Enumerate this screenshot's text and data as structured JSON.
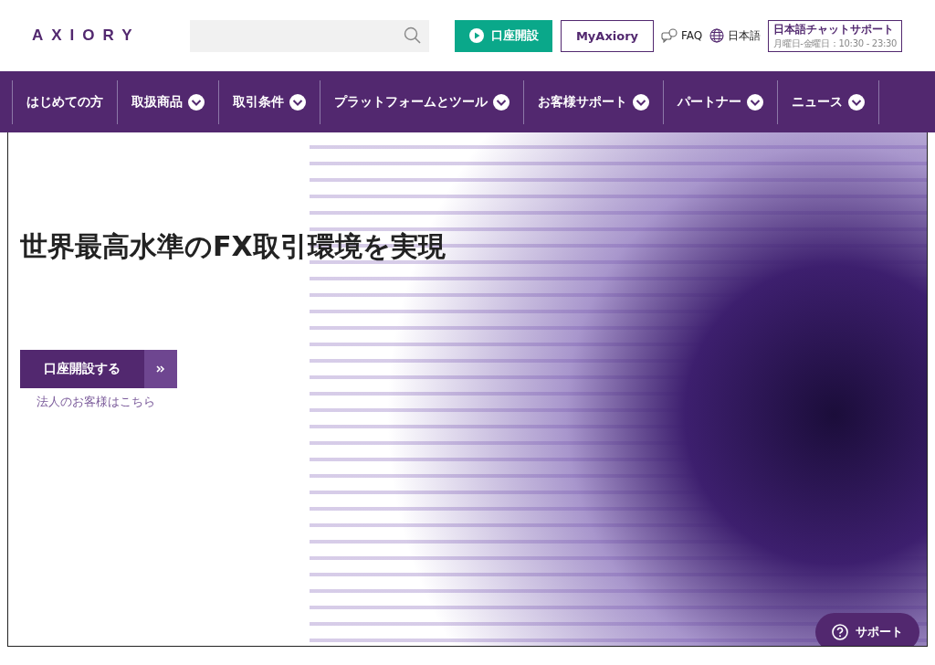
{
  "header": {
    "logo": "AXIORY",
    "open_account_button": "口座開設",
    "myaxiory_button": "MyAxiory",
    "faq_link": "FAQ",
    "language_link": "日本語",
    "chat_support": {
      "title": "日本語チャットサポート",
      "hours": "月曜日-金曜日：10:30 - 23:30"
    }
  },
  "nav": [
    {
      "label": "はじめての方",
      "dropdown": false
    },
    {
      "label": "取扱商品",
      "dropdown": true
    },
    {
      "label": "取引条件",
      "dropdown": true
    },
    {
      "label": "プラットフォームとツール",
      "dropdown": true
    },
    {
      "label": "お客様サポート",
      "dropdown": true
    },
    {
      "label": "パートナー",
      "dropdown": true
    },
    {
      "label": "ニュース",
      "dropdown": true
    }
  ],
  "hero": {
    "headline": "世界最高水準のFX取引環境を実現",
    "cta_button": "口座開設する",
    "corporate_link": "法人のお客様はこちら"
  },
  "support_button": "サポート"
}
